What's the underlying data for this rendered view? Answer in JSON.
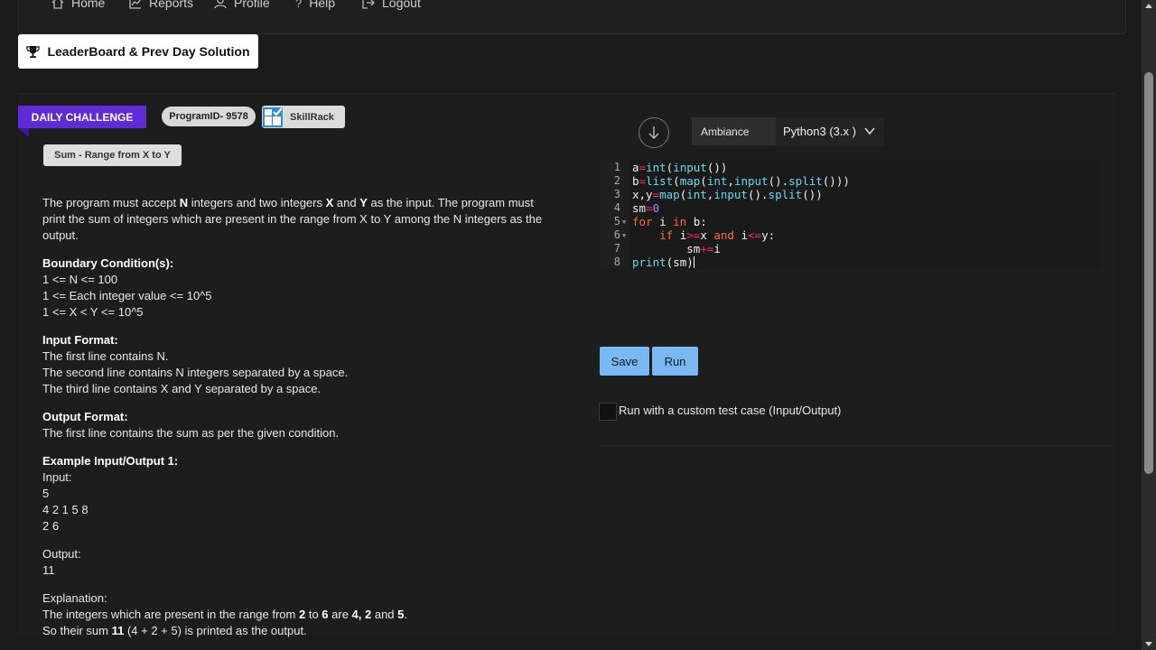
{
  "nav": {
    "home": "Home",
    "reports": "Reports",
    "profile": "Profile",
    "help": "Help",
    "logout": "Logout"
  },
  "leaderboard_button": "LeaderBoard & Prev Day Solution",
  "ribbon": "DAILY CHALLENGE",
  "program_id": "ProgramID- 9578",
  "brand": "SkillRack",
  "problem_title": "Sum - Range from X to Y",
  "problem": {
    "desc_1": "The program must accept ",
    "desc_n": "N",
    "desc_2": " integers and two integers ",
    "desc_x": "X",
    "desc_3": " and ",
    "desc_y": "Y",
    "desc_4": " as the input. The program must print the sum of integers which are present in the range from X to Y among the N integers as the output.",
    "boundary_heading": "Boundary Condition(s):",
    "boundary": [
      "1 <= N <= 100",
      "1 <= Each integer value <= 10^5",
      "1 <= X < Y <= 10^5"
    ],
    "input_heading": "Input Format:",
    "input": [
      "The first line contains N.",
      "The second line contains N integers separated by a space.",
      "The third line contains X and Y separated by a space."
    ],
    "output_heading": "Output Format:",
    "output": [
      "The first line contains the sum as per the given condition."
    ],
    "example_heading": "Example Input/Output 1:",
    "example_input_label": "Input:",
    "example_input": [
      "5",
      "4 2 1 5 8",
      "2 6"
    ],
    "example_output_label": "Output:",
    "example_output": "11",
    "explanation_label": "Explanation:",
    "expl_1": "The integers which are present in the range from ",
    "expl_2v": "2",
    "expl_3": " to ",
    "expl_6v": "6",
    "expl_4": " are ",
    "expl_nums": "4, 2",
    "expl_5": " and ",
    "expl_5v": "5",
    "expl_6": ".",
    "expl2_1": "So their sum ",
    "expl2_sum": "11",
    "expl2_2": " (4 + 2 + 5) is printed as the output."
  },
  "editor": {
    "theme": "Ambiance",
    "language": "Python3 (3.x )",
    "line_numbers": [
      "1",
      "2",
      "3",
      "4",
      "5",
      "6",
      "7",
      "8"
    ]
  },
  "buttons": {
    "save": "Save",
    "run": "Run"
  },
  "custom_test_label": "Run with a custom test case (Input/Output)"
}
